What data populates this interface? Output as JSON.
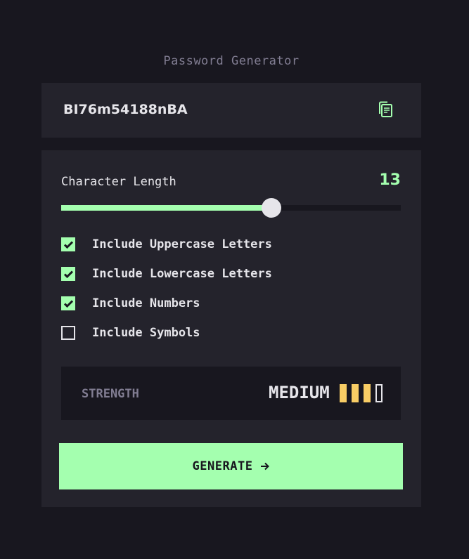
{
  "title": "Password Generator",
  "password": "BI76m54188nBA",
  "icons": {
    "copy": "copy-icon",
    "check": "check-icon",
    "arrow": "arrow-right-icon"
  },
  "length": {
    "label": "Character Length",
    "value": "13",
    "slider_fraction": 0.62
  },
  "options": [
    {
      "label": "Include Uppercase Letters",
      "checked": true
    },
    {
      "label": "Include Lowercase Letters",
      "checked": true
    },
    {
      "label": "Include Numbers",
      "checked": true
    },
    {
      "label": "Include Symbols",
      "checked": false
    }
  ],
  "strength": {
    "label": "STRENGTH",
    "level": "MEDIUM",
    "bars_filled": 3,
    "bars_total": 4
  },
  "generate": {
    "label": "GENERATE"
  },
  "colors": {
    "background": "#18171f",
    "panel": "#24232c",
    "accent": "#a4ffaf",
    "muted": "#817d92",
    "text": "#e6e5ea",
    "medium": "#f8cd65"
  }
}
